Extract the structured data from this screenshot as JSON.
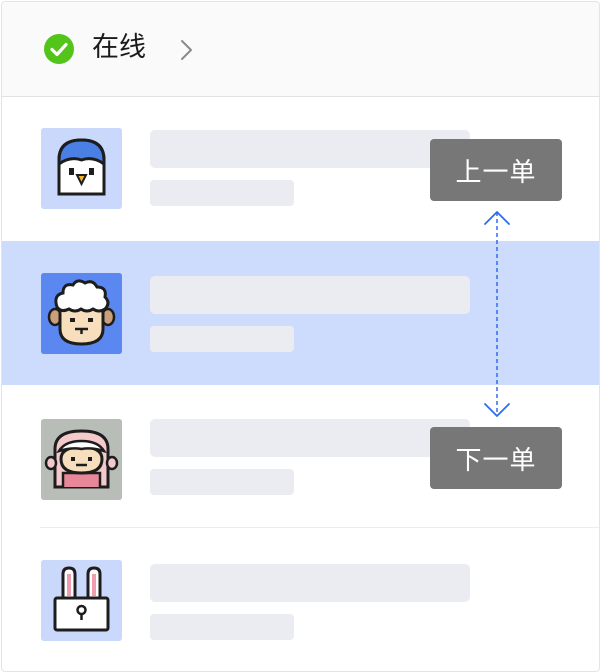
{
  "header": {
    "status_label": "在线",
    "status_color": "#52c41a",
    "status_icon": "check-circle-icon",
    "chevron_icon": "chevron-right-icon"
  },
  "list": {
    "items": [
      {
        "avatar": "penguin-avatar",
        "avatar_bg": "#c9d8fb",
        "selected": false
      },
      {
        "avatar": "sheep-avatar",
        "avatar_bg": "#5b87f0",
        "selected": true
      },
      {
        "avatar": "lamb-avatar",
        "avatar_bg": "#b9bdb8",
        "selected": false
      },
      {
        "avatar": "rabbit-avatar",
        "avatar_bg": "#c9d8fb",
        "selected": false
      }
    ],
    "selected_bg": "#cddcfc"
  },
  "navigation": {
    "prev_label": "上一单",
    "next_label": "下一单",
    "button_color": "#777777",
    "arrow_icon": "double-arrow-vertical-icon",
    "arrow_color": "#2e6cf0"
  }
}
